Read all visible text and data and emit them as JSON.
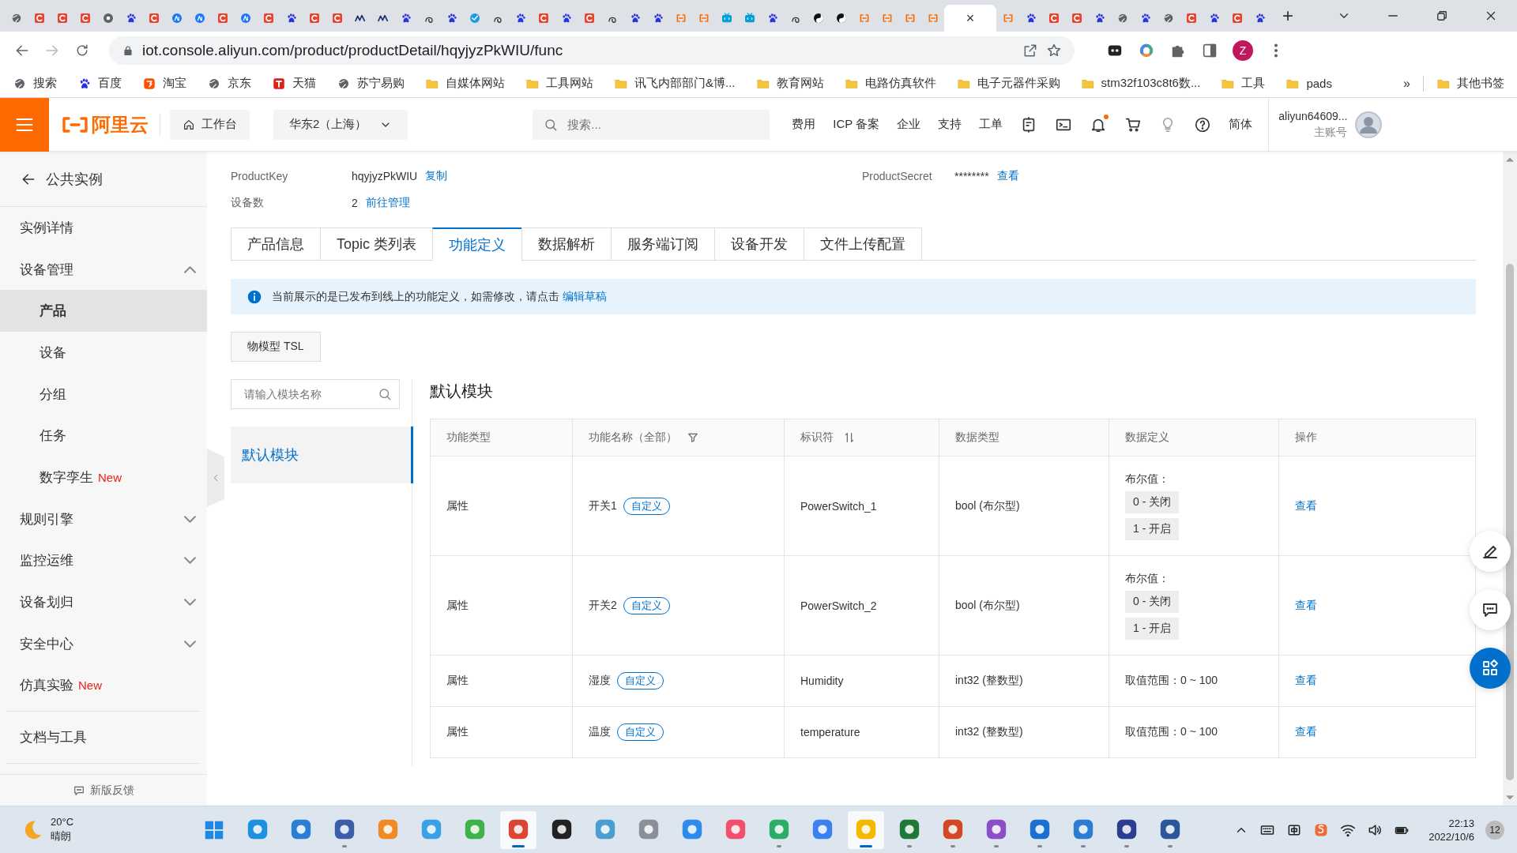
{
  "browser": {
    "tabs": [
      {
        "selected": false
      },
      {
        "selected": false
      },
      {
        "selected": false
      },
      {
        "selected": false
      },
      {
        "selected": false
      },
      {
        "selected": false
      },
      {
        "selected": false
      },
      {
        "selected": false
      },
      {
        "selected": false
      },
      {
        "selected": false
      },
      {
        "selected": false
      },
      {
        "selected": false
      },
      {
        "selected": false
      },
      {
        "selected": false
      },
      {
        "selected": false
      },
      {
        "selected": false
      },
      {
        "selected": false
      },
      {
        "selected": false
      },
      {
        "selected": false
      },
      {
        "selected": false
      },
      {
        "selected": false
      },
      {
        "selected": false
      },
      {
        "selected": false
      },
      {
        "selected": false
      },
      {
        "selected": false
      },
      {
        "selected": false
      },
      {
        "selected": false
      },
      {
        "selected": false
      },
      {
        "selected": false
      },
      {
        "selected": false
      },
      {
        "selected": false
      },
      {
        "selected": false
      },
      {
        "selected": false
      },
      {
        "selected": false
      },
      {
        "selected": false
      },
      {
        "selected": false
      },
      {
        "selected": false
      },
      {
        "selected": false
      },
      {
        "selected": false
      },
      {
        "selected": false
      },
      {
        "selected": false
      },
      {
        "selected": true,
        "close": "×"
      },
      {
        "selected": false
      },
      {
        "selected": false
      },
      {
        "selected": false
      },
      {
        "selected": false
      },
      {
        "selected": false
      },
      {
        "selected": false
      },
      {
        "selected": false
      },
      {
        "selected": false
      },
      {
        "selected": false
      },
      {
        "selected": false
      },
      {
        "selected": false
      },
      {
        "selected": false
      }
    ],
    "new_tab": "+",
    "url": "iot.console.aliyun.com/product/productDetail/hqyjyzPkWIU/func",
    "profile_initial": "Z",
    "bookmarks": [
      {
        "label": "搜索",
        "kind": "site"
      },
      {
        "label": "百度",
        "kind": "site"
      },
      {
        "label": "淘宝",
        "kind": "site"
      },
      {
        "label": "京东",
        "kind": "site"
      },
      {
        "label": "天猫",
        "kind": "site"
      },
      {
        "label": "苏宁易购",
        "kind": "site"
      },
      {
        "label": "自媒体网站",
        "kind": "folder"
      },
      {
        "label": "工具网站",
        "kind": "folder"
      },
      {
        "label": "讯飞内部部门&博...",
        "kind": "folder"
      },
      {
        "label": "教育网站",
        "kind": "folder"
      },
      {
        "label": "电路仿真软件",
        "kind": "folder"
      },
      {
        "label": "电子元器件采购",
        "kind": "folder"
      },
      {
        "label": "stm32f103c8t6数...",
        "kind": "folder"
      },
      {
        "label": "工具",
        "kind": "folder"
      },
      {
        "label": "pads",
        "kind": "folder"
      }
    ],
    "more": "»",
    "other_bookmarks": "其他书签"
  },
  "header": {
    "logo": "阿里云",
    "workbench": "工作台",
    "region": "华东2（上海）",
    "search_placeholder": "搜索...",
    "links": [
      "费用",
      "ICP 备案",
      "企业",
      "支持",
      "工单"
    ],
    "notification_dot": true,
    "language": "简体",
    "account": "aliyun64609...",
    "account_type": "主账号"
  },
  "sidebar": {
    "back": "公共实例",
    "items": [
      {
        "label": "实例详情",
        "selected": false
      },
      {
        "label": "设备管理",
        "selected": false,
        "expanded": true,
        "children": [
          {
            "label": "产品",
            "selected": true
          },
          {
            "label": "设备",
            "selected": false
          },
          {
            "label": "分组",
            "selected": false
          },
          {
            "label": "任务",
            "selected": false
          },
          {
            "label": "数字孪生",
            "selected": false,
            "badge": "New"
          }
        ]
      },
      {
        "label": "规则引擎",
        "selected": false,
        "expanded": false
      },
      {
        "label": "监控运维",
        "selected": false,
        "expanded": false
      },
      {
        "label": "设备划归",
        "selected": false,
        "expanded": false
      },
      {
        "label": "安全中心",
        "selected": false,
        "expanded": false
      },
      {
        "label": "仿真实验",
        "selected": false,
        "badge": "New"
      },
      {
        "label": "文档与工具",
        "selected": false,
        "divider_before": true
      }
    ],
    "feedback": "新版反馈"
  },
  "product": {
    "key_label": "ProductKey",
    "key": "hqyjyzPkWIU",
    "copy": "复制",
    "secret_label": "ProductSecret",
    "secret": "********",
    "secret_view": "查看",
    "count_label": "设备数",
    "count": "2",
    "manage": "前往管理"
  },
  "tabs": [
    {
      "label": "产品信息",
      "selected": false
    },
    {
      "label": "Topic 类列表",
      "selected": false
    },
    {
      "label": "功能定义",
      "selected": true
    },
    {
      "label": "数据解析",
      "selected": false
    },
    {
      "label": "服务端订阅",
      "selected": false
    },
    {
      "label": "设备开发",
      "selected": false
    },
    {
      "label": "文件上传配置",
      "selected": false
    }
  ],
  "notice": {
    "text": "当前展示的是已发布到线上的功能定义，如需修改，请点击",
    "link": "编辑草稿"
  },
  "tsl_button": "物模型 TSL",
  "modules": {
    "search_placeholder": "请输入模块名称",
    "items": [
      {
        "label": "默认模块",
        "selected": true
      }
    ]
  },
  "module_title": "默认模块",
  "table": {
    "columns": [
      {
        "label": "功能类型",
        "kind": "plain"
      },
      {
        "label": "功能名称（全部）",
        "kind": "filter"
      },
      {
        "label": "标识符",
        "kind": "sort"
      },
      {
        "label": "数据类型",
        "kind": "plain"
      },
      {
        "label": "数据定义",
        "kind": "plain"
      },
      {
        "label": "操作",
        "kind": "plain"
      }
    ],
    "rows": [
      {
        "type": "属性",
        "name": "开关1",
        "tag": "自定义",
        "identifier": "PowerSwitch_1",
        "data_type": "bool (布尔型)",
        "definition": {
          "kind": "bool",
          "label": "布尔值：",
          "values": [
            "0 - 关闭",
            "1 - 开启"
          ]
        },
        "action": "查看"
      },
      {
        "type": "属性",
        "name": "开关2",
        "tag": "自定义",
        "identifier": "PowerSwitch_2",
        "data_type": "bool (布尔型)",
        "definition": {
          "kind": "bool",
          "label": "布尔值：",
          "values": [
            "0 - 关闭",
            "1 - 开启"
          ]
        },
        "action": "查看"
      },
      {
        "type": "属性",
        "name": "湿度",
        "tag": "自定义",
        "identifier": "Humidity",
        "data_type": "int32 (整数型)",
        "definition": {
          "kind": "range",
          "text": "取值范围：0 ~ 100"
        },
        "action": "查看"
      },
      {
        "type": "属性",
        "name": "温度",
        "tag": "自定义",
        "identifier": "temperature",
        "data_type": "int32 (整数型)",
        "definition": {
          "kind": "range",
          "text": "取值范围：0 ~ 100"
        },
        "action": "查看"
      }
    ]
  },
  "taskbar": {
    "temperature": "20°C",
    "weather": "晴朗",
    "apps": [
      {
        "color": "#1e90e0",
        "running": false,
        "active": false
      },
      {
        "color": "#2a7fd4",
        "running": false,
        "active": false
      },
      {
        "color": "#3a5fa8",
        "running": true,
        "active": false
      },
      {
        "color": "#f08a24",
        "running": false,
        "active": false
      },
      {
        "color": "#3aa0e8",
        "running": false,
        "active": false
      },
      {
        "color": "#3db34a",
        "running": false,
        "active": false
      },
      {
        "color": "#db4437",
        "running": true,
        "active": true
      },
      {
        "color": "#222222",
        "running": false,
        "active": false
      },
      {
        "color": "#4a9fd0",
        "running": false,
        "active": false
      },
      {
        "color": "#8a8f99",
        "running": false,
        "active": false
      },
      {
        "color": "#2d8ceb",
        "running": false,
        "active": false
      },
      {
        "color": "#f0506e",
        "running": false,
        "active": false
      },
      {
        "color": "#2aae67",
        "running": true,
        "active": false
      },
      {
        "color": "#3a80f0",
        "running": false,
        "active": false
      },
      {
        "color": "#f5b800",
        "running": true,
        "active": true
      },
      {
        "color": "#1f7a3a",
        "running": true,
        "active": false
      },
      {
        "color": "#d24726",
        "running": true,
        "active": false
      },
      {
        "color": "#8a4fc8",
        "running": true,
        "active": false
      },
      {
        "color": "#1a6fd0",
        "running": true,
        "active": false
      },
      {
        "color": "#2b7cd3",
        "running": true,
        "active": false
      },
      {
        "color": "#2a3f8f",
        "running": true,
        "active": false
      },
      {
        "color": "#2b579a",
        "running": true,
        "active": false
      }
    ],
    "time": "22:13",
    "date": "2022/10/6",
    "notifications": "12"
  }
}
